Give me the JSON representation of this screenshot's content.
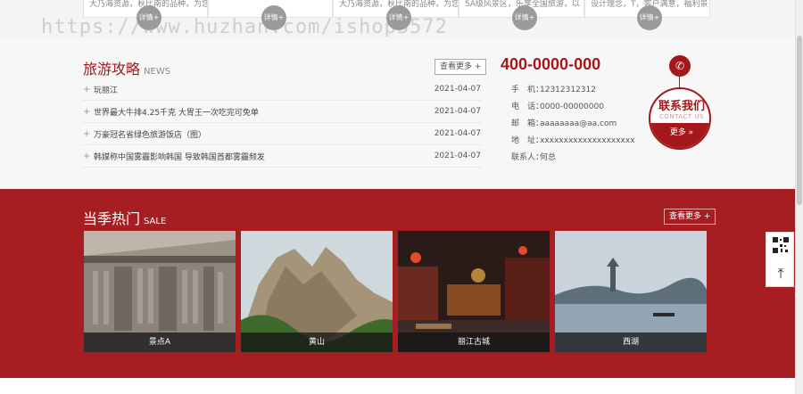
{
  "top_cards": [
    {
      "snippet": "大乃海资源，秋比南的品种，为您",
      "detail": "详情+"
    },
    {
      "snippet": "",
      "detail": "详情+"
    },
    {
      "snippet": "大乃海资源，秋比南的品种，为您",
      "detail": "详情+"
    },
    {
      "snippet": "5A级风景区，乐享全国旅游，以",
      "detail": "详情+"
    },
    {
      "snippet": "设计理念，T，客户满意，福利景",
      "detail": "详情+"
    }
  ],
  "watermark": "https://www.huzhan.com/ishop3572",
  "guide": {
    "title": "旅游攻略",
    "title_en": "NEWS",
    "more": "查看更多 +",
    "items": [
      {
        "title": "玩丽江",
        "date": "2021-04-07"
      },
      {
        "title": "世界最大牛排4.25千克 大胃王一次吃完可免单",
        "date": "2021-04-07"
      },
      {
        "title": "万豪冠名省绿色旅游饭店（图）",
        "date": "2021-04-07"
      },
      {
        "title": "韩媒称中国雾霾影响韩国 导致韩国首都雾霾频发",
        "date": "2021-04-07"
      }
    ]
  },
  "contact": {
    "phone": "400-0000-000",
    "rows": [
      {
        "k": "手　机：",
        "v": "12312312312"
      },
      {
        "k": "电　话：",
        "v": "0000-00000000"
      },
      {
        "k": "邮　箱：",
        "v": "aaaaaaaa@aa.com"
      },
      {
        "k": "地　址：",
        "v": "xxxxxxxxxxxxxxxxxxxx"
      },
      {
        "k": "联系人：",
        "v": "何总"
      }
    ],
    "badge_cn": "联系我们",
    "badge_en": "CONTACT US",
    "badge_more": "更多 »"
  },
  "hot": {
    "title": "当季热门",
    "title_en": "SALE",
    "more": "查看更多 +",
    "items": [
      {
        "caption": "景点A"
      },
      {
        "caption": "黄山"
      },
      {
        "caption": "丽江古城"
      },
      {
        "caption": "西湖"
      }
    ]
  },
  "colors": {
    "brand_red": "#a61e22",
    "text_red": "#a4181c"
  }
}
